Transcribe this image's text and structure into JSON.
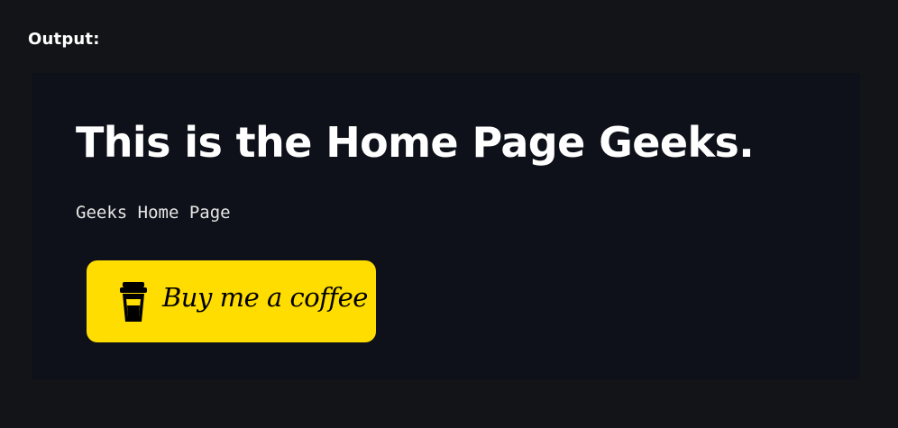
{
  "output_label": "Output:",
  "page": {
    "heading": "This is the Home Page Geeks.",
    "subtext": "Geeks Home Page"
  },
  "button": {
    "label": "Buy me a coffee",
    "icon": "coffee-cup-icon",
    "background": "#ffdd00",
    "text_color": "#000000"
  },
  "colors": {
    "outer_background": "#131418",
    "panel_background": "#0e1119",
    "heading_color": "#ffffff"
  }
}
